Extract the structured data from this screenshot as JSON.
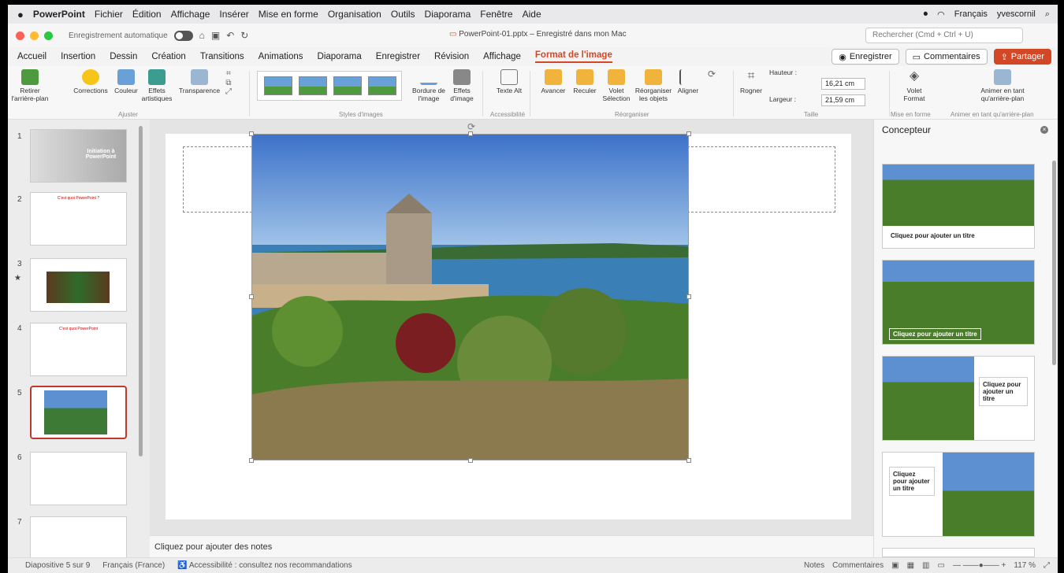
{
  "menubar": {
    "app_name": "PowerPoint",
    "items": [
      "Fichier",
      "Édition",
      "Affichage",
      "Insérer",
      "Mise en forme",
      "Organisation",
      "Outils",
      "Diaporama",
      "Fenêtre",
      "Aide"
    ],
    "input_language": "Français",
    "username": "yvescornil"
  },
  "titlebar": {
    "autosave_label": "Enregistrement automatique",
    "doc_title": "PowerPoint-01.pptx – Enregistré dans mon Mac",
    "search_placeholder": "Rechercher (Cmd + Ctrl + U)"
  },
  "tabs": [
    "Accueil",
    "Insertion",
    "Dessin",
    "Création",
    "Transitions",
    "Animations",
    "Diaporama",
    "Enregistrer",
    "Révision",
    "Affichage",
    "Format de l'image"
  ],
  "active_tab": "Format de l'image",
  "actions": {
    "record": "Enregistrer",
    "comments": "Commentaires",
    "share": "Partager"
  },
  "ribbon": {
    "remove_bg": "Retirer l'arrière-plan",
    "corrections": "Corrections",
    "couleur": "Couleur",
    "effets_artistiques": "Effets artistiques",
    "transparence": "Transparence",
    "group_ajuster": "Ajuster",
    "group_styles": "Styles d'images",
    "bordure": "Bordure de l'image",
    "effets": "Effets d'image",
    "texte_alt": "Texte Alt",
    "group_access": "Accessibilité",
    "avancer": "Avancer",
    "reculer": "Reculer",
    "volet_selection": "Volet Sélection",
    "reorganiser": "Réorganiser les objets",
    "aligner": "Aligner",
    "group_reorg": "Réorganiser",
    "rogner": "Rogner",
    "hauteur_label": "Hauteur :",
    "hauteur_value": "16,21 cm",
    "largeur_label": "Largeur :",
    "largeur_value": "21,59 cm",
    "group_taille": "Taille",
    "volet_format": "Volet Format",
    "group_mise": "Mise en forme",
    "animer": "Animer en tant qu'arrière-plan",
    "group_animer": "Animer en tant qu'arrière-plan"
  },
  "slides": [
    {
      "num": "1",
      "title": "Initiation à PowerPoint"
    },
    {
      "num": "2",
      "title": "C'est quoi PowerPoint ?"
    },
    {
      "num": "3",
      "title": ""
    },
    {
      "num": "4",
      "title": "C'est quoi PowerPoint"
    },
    {
      "num": "5",
      "title": ""
    },
    {
      "num": "6",
      "title": ""
    },
    {
      "num": "7",
      "title": ""
    }
  ],
  "notes_placeholder": "Cliquez pour ajouter des notes",
  "designer": {
    "title": "Concepteur",
    "card_caption": "Cliquez pour ajouter un titre"
  },
  "status": {
    "slide_pos": "Diapositive 5 sur 9",
    "language": "Français (France)",
    "accessibility": "Accessibilité : consultez nos recommandations",
    "notes": "Notes",
    "comments": "Commentaires",
    "zoom": "117 %"
  },
  "colors": {
    "accent": "#d24726",
    "selected_slide": "#c0392b"
  }
}
